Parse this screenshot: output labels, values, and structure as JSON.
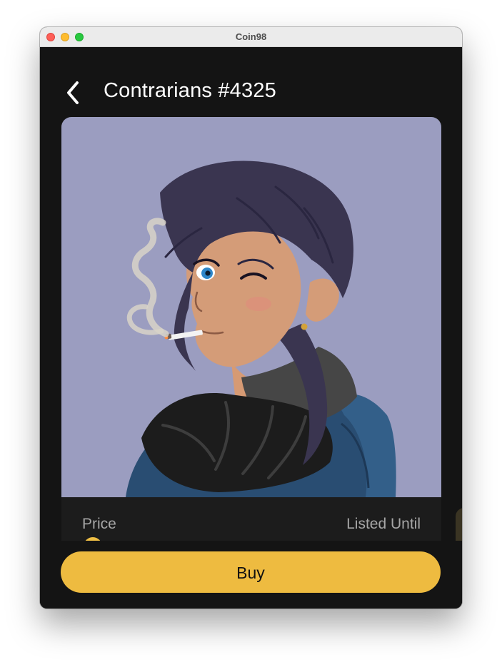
{
  "window": {
    "title": "Coin98"
  },
  "header": {
    "back_icon": "chevron-left-icon",
    "title": "Contrarians #4325"
  },
  "nft": {
    "image_description_icon": "nft-artwork",
    "background_color": "#9b9dc0"
  },
  "info": {
    "price_label": "Price",
    "listed_until_label": "Listed Until",
    "coin_icon": "token-coin-icon"
  },
  "actions": {
    "buy_label": "Buy"
  },
  "colors": {
    "background": "#141414",
    "card": "#1c1c1c",
    "accent": "#eebb40",
    "muted_text": "#a6a6a6"
  }
}
